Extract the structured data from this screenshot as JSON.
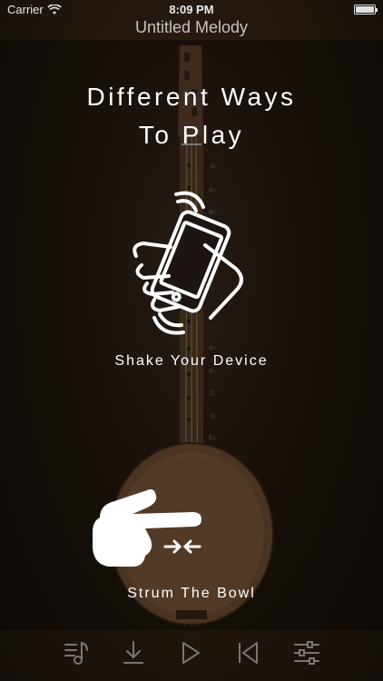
{
  "status_bar": {
    "carrier": "Carrier",
    "time": "8:09 PM",
    "battery_level": 1.0
  },
  "nav": {
    "title": "Untitled Melody"
  },
  "fretboard_notes": [
    "G",
    "A♭",
    "B♭",
    "A♭",
    "B♭",
    "C",
    "D",
    "E♭"
  ],
  "overlay": {
    "headline_line1": "Different Ways",
    "headline_line2": "To Play",
    "shake_caption": "Shake Your Device",
    "strum_caption": "Strum The Bowl"
  },
  "toolbar": {
    "icons": [
      "melody-list-icon",
      "download-icon",
      "play-icon",
      "rewind-icon",
      "settings-sliders-icon"
    ]
  },
  "colors": {
    "background": "#1a1411",
    "wood": "#7a5537",
    "toolbar_icon": "#7d7670"
  }
}
